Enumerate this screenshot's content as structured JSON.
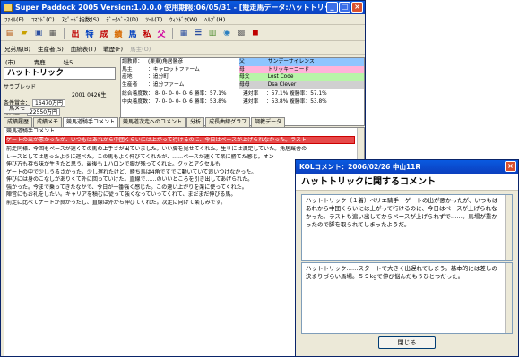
{
  "main_window": {
    "title": "Super Paddock 2005 Version:1.0.0.0 使用期限:06/05/31 - [競走馬データ:ハットトリック]",
    "menu": [
      "ﾌｧｲﾙ(F)",
      "ｺﾏﾝﾄﾞ(C)",
      "ｽﾋﾟｰﾄﾞ指数(S)",
      "ﾃﾞｰﾀﾍﾞｰｽ(D)",
      "ﾂｰﾙ(T)",
      "ｳｨﾝﾄﾞｳ(W)",
      "ﾍﾙﾌﾟ(H)"
    ],
    "toolbar_glyphs": [
      "出",
      "特",
      "成",
      "績",
      "馬",
      "私",
      "父"
    ],
    "subtoolbar": {
      "items": [
        "兄弟馬(B)",
        "生産者(S)",
        "血統表(T)",
        "戦歴(F)"
      ],
      "disabled": "馬主(O)"
    }
  },
  "horse": {
    "region": "(市)",
    "color": "青鹿",
    "sex_age": "牡5",
    "name": "ハットトリック",
    "breed_line": "サラブレッド",
    "birth": "2001 0426生",
    "prize_label": "条件賞金：",
    "prize_value": "16470万円",
    "total_label": "総賞金：",
    "total_value": "22550万円",
    "menu_button": "馬メモ"
  },
  "info_rows": [
    {
      "key": "調教師：",
      "val": "(栗東)角居勝彦",
      "pkey": "父",
      "pval": "：サンデーサイレンス"
    },
    {
      "key": "馬主",
      "val": "：キャロットファーム",
      "pkey": "母",
      "pval": "：トリッキーコード"
    },
    {
      "key": "産地",
      "val": "：追分町",
      "pkey": "母父",
      "pval": "：Lost Code"
    },
    {
      "key": "生産者",
      "val": "：追分ファーム",
      "pkey": "母母",
      "pval": "：Dsa Clever"
    },
    {
      "key": "総合着度数：",
      "val": "8- 0- 0- 0- 0- 6 勝率：57.1%",
      "pkey": "連対率",
      "pval": "：57.1% 複勝率：57.1%"
    },
    {
      "key": "中央着度数：",
      "val": "7- 0- 0- 0- 0- 6 勝率：53.8%",
      "pkey": "連対率",
      "pval": "：53.8% 複勝率：53.8%"
    }
  ],
  "tabs": [
    "成績履歴",
    "成績メモ",
    "競馬道騎手コメント",
    "競馬道次走へのコメント",
    "分析",
    "成長曲線グラフ",
    "調教データ"
  ],
  "active_tab": 2,
  "comment_area": {
    "title": "競馬道騎手コメント",
    "highlight": "ゲートの出が悪かったが、いつもはあれから中団くらいには上がって行けるのに、今日はペースが上げられなかった。ラスト",
    "lines": [
      "前走同様、今回もペースが速くての馬の上手さが出ていました。いい脚を見せてくれた。生リには満足していた。角居厩舎の",
      "レースとしては思ったように運べた。この馬もよく伸びてくれたが、……ペースが速くて楽に勝てた感じ。オン",
      "伸び方も持ち味が生きたと思う。最後も１ハロンで脚が残ってくれた。クッとアクセルも",
      "ゲートの中で少しうるさかった。少し遅れたけど、勝ち馬は4角ですでに動いていて追いつけなかった。",
      "伸びには身のこなしがありくて外に回っていけた。直線で……のいいところを引き出してあげられた。",
      "強かった。今まで乗ってきたなかで、今日が一番強く感じた。この速い上がりを楽に使ってくれた。",
      "陣営にもお礼をしたい。キャリアを積むに従って強くなっていってくれて、まだまだ伸びる馬。",
      "前走に比べてゲートが良かったし、直線は外から伸びてくれた。次走に向けて楽しみです。"
    ]
  },
  "dialog": {
    "title": "KOLコメント：2006/02/26 中山11R",
    "heading": "ハットトリックに関するコメント",
    "comment1": "ハットトリック（１着）ペリエ騎手　ゲートの出が悪かったが、いつもはあれから中団くらいには上がって行けるのに、今日はペースが上げられなかった。ラストも追い出してからペースが上げられずで……。馬場が重かったので脚を取られてしまったようだ。",
    "comment2": "ハットトリック……スタートで大きく出遅れてしまう。基本的には差しの決まりづらい馬場。５９kgで伸び悩んだもうひとつだった。",
    "close_button": "閉じる"
  }
}
